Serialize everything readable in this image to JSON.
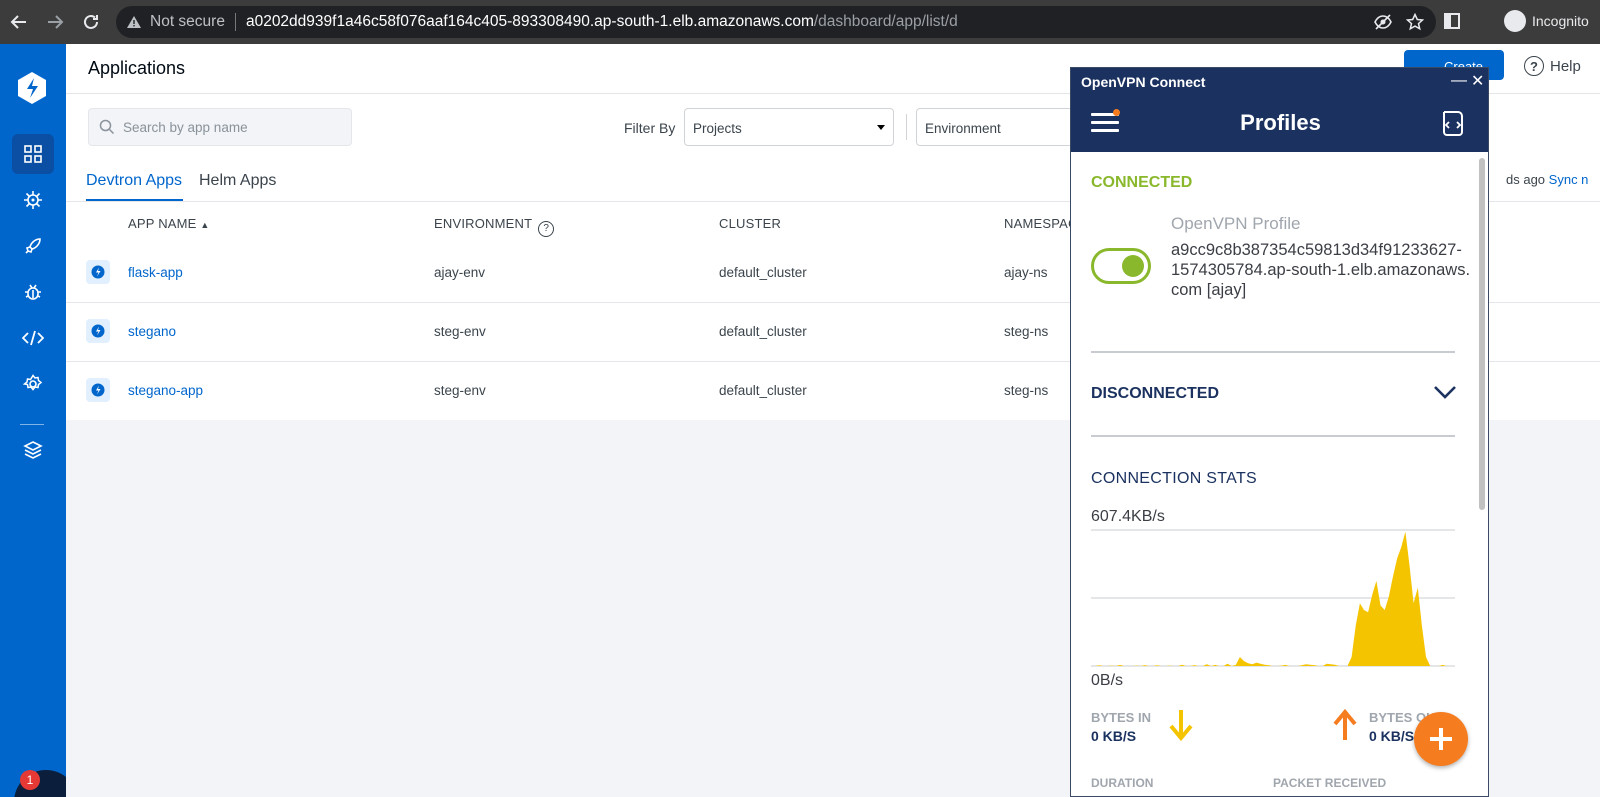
{
  "browser": {
    "security_label": "Not secure",
    "url_host": "a0202dd939f1a46c58f076aaf164c405-893308490.ap-south-1.elb.amazonaws.com",
    "url_path": "/dashboard/app/list/d",
    "profile_label": "Incognito"
  },
  "header": {
    "title": "Applications",
    "create_label": "Create",
    "help_label": "Help"
  },
  "filters": {
    "search_placeholder": "Search by app name",
    "filter_by_label": "Filter By",
    "projects_value": "Projects",
    "environment_value": "Environment"
  },
  "tabs": [
    {
      "label": "Devtron Apps",
      "active": true
    },
    {
      "label": "Helm Apps",
      "active": false
    }
  ],
  "sync": {
    "text": "ds ago",
    "link": "Sync n"
  },
  "table": {
    "columns": [
      "APP NAME",
      "ENVIRONMENT",
      "CLUSTER",
      "NAMESPACE"
    ],
    "rows": [
      {
        "name": "flask-app",
        "environment": "ajay-env",
        "cluster": "default_cluster",
        "namespace": "ajay-ns"
      },
      {
        "name": "stegano",
        "environment": "steg-env",
        "cluster": "default_cluster",
        "namespace": "steg-ns"
      },
      {
        "name": "stegano-app",
        "environment": "steg-env",
        "cluster": "default_cluster",
        "namespace": "steg-ns"
      }
    ]
  },
  "chat": {
    "badge_count": "1"
  },
  "vpn": {
    "window_title": "OpenVPN Connect",
    "header_title": "Profiles",
    "status_connected": "CONNECTED",
    "profile_name": "OpenVPN Profile",
    "profile_host": "a9cc9c8b387354c59813d34f91233627-1574305784.ap-south-1.elb.amazonaws.com [ajay]",
    "toggle_on": true,
    "status_disconnected": "DISCONNECTED",
    "stats_title": "CONNECTION STATS",
    "speed_max": "607.4KB/s",
    "speed_min": "0B/s",
    "bytes_in_label": "BYTES IN",
    "bytes_in_value": "0 KB/S",
    "bytes_out_label": "BYTES OUT",
    "bytes_out_value": "0 KB/S",
    "duration_label": "DURATION",
    "packet_label": "PACKET RECEIVED",
    "accent_green": "#8ab82c",
    "accent_orange": "#f57c1f",
    "graph_color": "#f5c400"
  },
  "chart_data": {
    "type": "area",
    "title": "",
    "xlabel": "",
    "ylabel": "",
    "ylim": [
      0,
      607.4
    ],
    "unit": "KB/s",
    "values": [
      0,
      0,
      3,
      0,
      0,
      2,
      0,
      5,
      0,
      0,
      0,
      2,
      0,
      4,
      0,
      0,
      3,
      0,
      0,
      2,
      0,
      0,
      6,
      0,
      0,
      4,
      0,
      0,
      8,
      0,
      5,
      0,
      0,
      10,
      0,
      5,
      40,
      22,
      12,
      8,
      15,
      10,
      6,
      3,
      0,
      0,
      2,
      5,
      0,
      0,
      0,
      4,
      8,
      6,
      4,
      0,
      0,
      10,
      8,
      6,
      0,
      0,
      0,
      40,
      180,
      280,
      250,
      240,
      320,
      380,
      270,
      250,
      310,
      400,
      480,
      530,
      600,
      450,
      280,
      350,
      180,
      40,
      0,
      0,
      0,
      5,
      0,
      0,
      0
    ]
  }
}
